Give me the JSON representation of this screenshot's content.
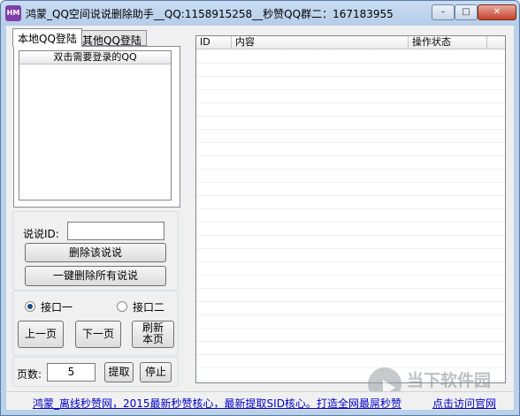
{
  "window": {
    "title": "鸿蒙_QQ空间说说删除助手__QQ:1158915258__秒赞QQ群二：167183955",
    "icon_text": "HM",
    "controls": {
      "minimize": "–",
      "maximize": "□",
      "close": "✕"
    }
  },
  "tabs": [
    {
      "label": "本地QQ登陆",
      "active": true
    },
    {
      "label": "其他QQ登陆",
      "active": false
    }
  ],
  "qq_list": {
    "header": "双击需要登录的QQ",
    "items": []
  },
  "shuoshuo": {
    "id_label": "说说ID:",
    "id_value": "",
    "delete_button": "删除该说说",
    "delete_all_button": "一键删除所有说说"
  },
  "interface": {
    "options": [
      {
        "label": "接口一",
        "selected": true
      },
      {
        "label": "接口二",
        "selected": false
      }
    ],
    "prev_button": "上一页",
    "next_button": "下一页",
    "refresh_button_line1": "刷新",
    "refresh_button_line2": "本页"
  },
  "pager": {
    "page_label": "页数:",
    "page_value": "5",
    "extract_button": "提取",
    "stop_button": "停止"
  },
  "result_table": {
    "columns": [
      "ID",
      "内容",
      "操作状态"
    ],
    "rows": []
  },
  "status_bar": {
    "left_link": "鸿蒙_离线秒赞网，2015最新秒赞核心，最新提取SID核心。打造全网最屌秒赞",
    "right_link": "点击访问官网"
  },
  "watermark": {
    "text": "当下软件园",
    "sub": "downxia.com"
  }
}
